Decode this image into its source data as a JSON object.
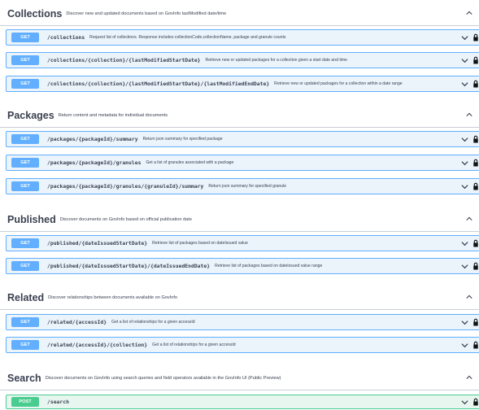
{
  "sections": [
    {
      "title": "Collections",
      "description": "Discover new and updated documents based on GovInfo lastModified date/time",
      "operations": [
        {
          "method": "GET",
          "path": "/collections",
          "summary": "Request list of collections. Response includes collectionCode,collectionName, package and granule counts"
        },
        {
          "method": "GET",
          "path": "/collections/{collection}/{lastModifiedStartDate}",
          "summary": "Retrieve new or updated packages for a collection given a start date and time"
        },
        {
          "method": "GET",
          "path": "/collections/{collection}/{lastModifiedStartDate}/{lastModifiedEndDate}",
          "summary": "Retrieve new or updated packages for a collection within a date range"
        }
      ]
    },
    {
      "title": "Packages",
      "description": "Return content and metadata for individual documents",
      "operations": [
        {
          "method": "GET",
          "path": "/packages/{packageId}/summary",
          "summary": "Return json summary for specified package"
        },
        {
          "method": "GET",
          "path": "/packages/{packageId}/granules",
          "summary": "Get a list of granules associated with a package"
        },
        {
          "method": "GET",
          "path": "/packages/{packageId}/granules/{granuleId}/summary",
          "summary": "Return json summary for specified granule"
        }
      ]
    },
    {
      "title": "Published",
      "description": "Discover documents on GovInfo based on official publication date",
      "operations": [
        {
          "method": "GET",
          "path": "/published/{dateIssuedStartDate}",
          "summary": "Retrieve list of packages based on dateIssued value"
        },
        {
          "method": "GET",
          "path": "/published/{dateIssuedStartDate}/{dateIssuedEndDate}",
          "summary": "Retrieve list of packages based on dateIssued value range"
        }
      ]
    },
    {
      "title": "Related",
      "description": "Discover relationships between documents available on GovInfo",
      "operations": [
        {
          "method": "GET",
          "path": "/related/{accessId}",
          "summary": "Get a list of relationships for a given accessId"
        },
        {
          "method": "GET",
          "path": "/related/{accessId}/{collection}",
          "summary": "Get a list of relationships for a given accessId"
        }
      ]
    },
    {
      "title": "Search",
      "description": "Discover documents on GovInfo using search queries and field operators available in the GovInfo UI (Public Preview)",
      "operations": [
        {
          "method": "POST",
          "path": "/search",
          "summary": ""
        }
      ]
    }
  ],
  "icons": {
    "section_toggle": "chevron-up-icon",
    "operation_toggle": "chevron-down-icon",
    "auth": "lock-icon"
  },
  "colors": {
    "get": "#61affe",
    "get_bg": "#ebf3fb",
    "post": "#49cc90",
    "post_bg": "#e8f6f0",
    "text": "#3b4151"
  }
}
